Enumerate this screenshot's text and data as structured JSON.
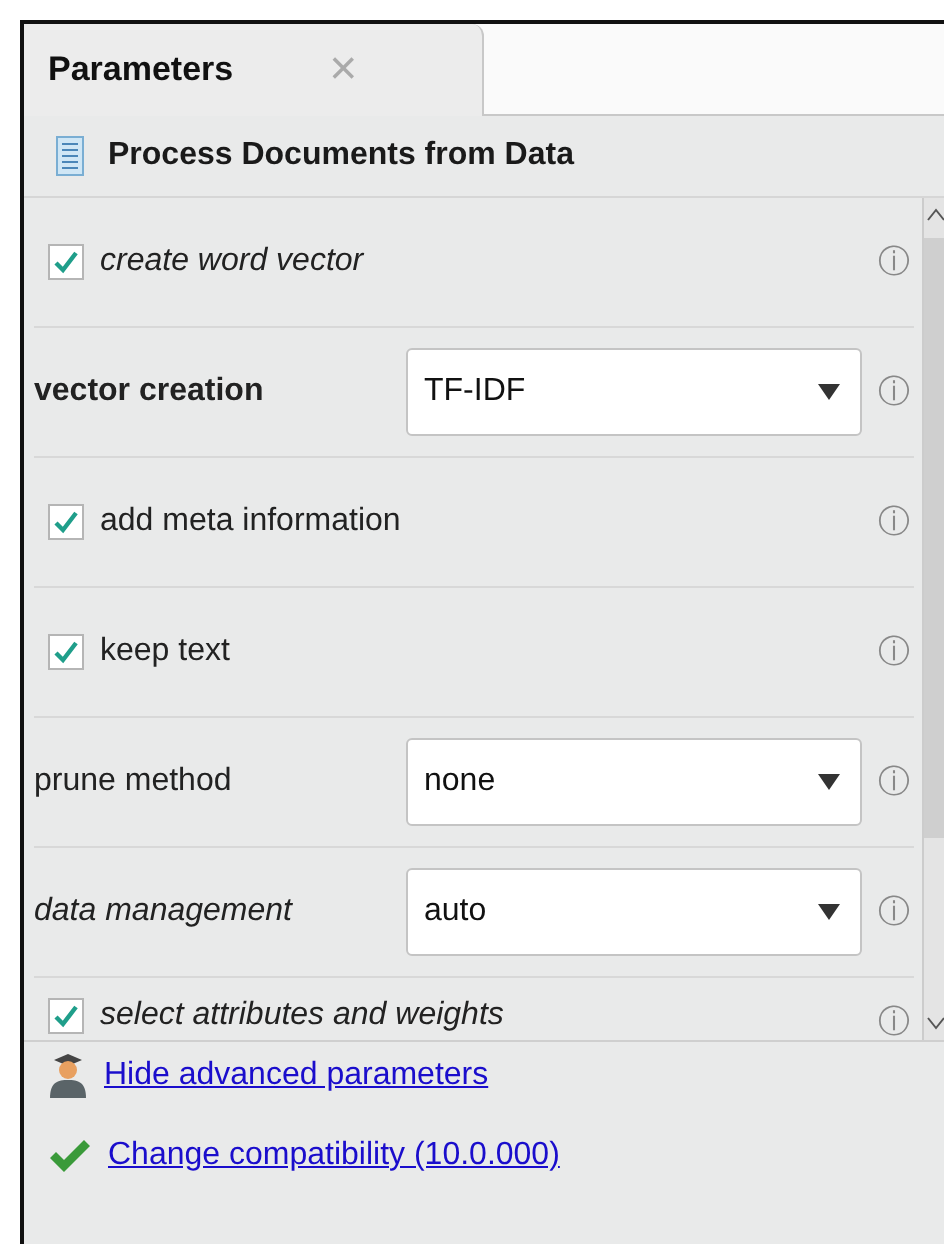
{
  "tab": {
    "label": "Parameters",
    "close": "×"
  },
  "operator": {
    "title": "Process Documents from Data"
  },
  "parameters": [
    {
      "kind": "checkbox",
      "label": "create word vector",
      "italic": true,
      "bold": false,
      "checked": true,
      "info": "ⓘ"
    },
    {
      "kind": "dropdown",
      "label": "vector creation",
      "italic": false,
      "bold": true,
      "value": "TF-IDF",
      "info": "ⓘ"
    },
    {
      "kind": "checkbox",
      "label": "add meta information",
      "italic": false,
      "bold": false,
      "checked": true,
      "info": "ⓘ"
    },
    {
      "kind": "checkbox",
      "label": "keep text",
      "italic": false,
      "bold": false,
      "checked": true,
      "info": "ⓘ"
    },
    {
      "kind": "dropdown",
      "label": "prune method",
      "italic": false,
      "bold": false,
      "value": "none",
      "info": "ⓘ"
    },
    {
      "kind": "dropdown",
      "label": "data management",
      "italic": true,
      "bold": false,
      "value": "auto",
      "info": "ⓘ"
    },
    {
      "kind": "checkbox",
      "label": "select attributes and weights",
      "italic": true,
      "bold": false,
      "checked": true,
      "info": "ⓘ"
    }
  ],
  "links": [
    {
      "kind": "advanced",
      "label": "Hide advanced parameters"
    },
    {
      "kind": "compatibility",
      "label": "Change compatibility (10.0.000)"
    }
  ]
}
